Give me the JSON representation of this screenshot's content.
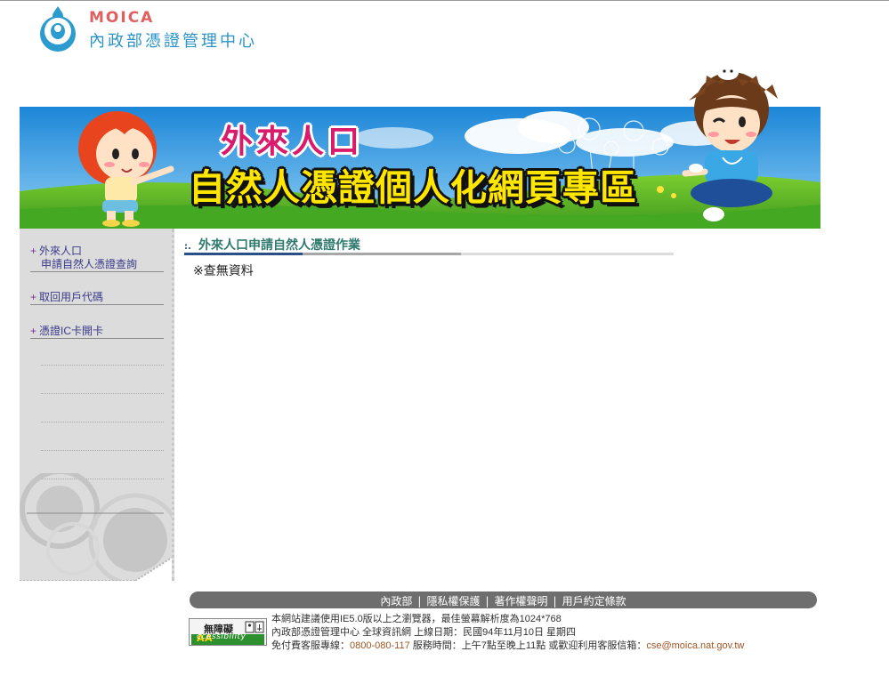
{
  "logo": {
    "en": "MOICA",
    "zh": "內政部憑證管理中心"
  },
  "banner": {
    "line1": "外來人口",
    "line2": "自然人憑證個人化網頁專區"
  },
  "sidebar": {
    "items": [
      {
        "plus": "+",
        "line1": "外來人口",
        "line2": "申請自然人憑證查詢"
      },
      {
        "plus": "+",
        "line1": "取回用戶代碼"
      },
      {
        "plus": "+",
        "line1": "憑證IC卡開卡"
      }
    ]
  },
  "main": {
    "title": "外來人口申請自然人憑證作業",
    "message": "※查無資料"
  },
  "footer": {
    "links": [
      "內政部",
      "隱私權保護",
      "著作權聲明",
      "用戶約定條款"
    ],
    "separator": "|",
    "badge_top": "無障礙",
    "badge_bottom_A": "AA",
    "badge_bottom_rest": "ccessibility",
    "line1": "本網站建議使用IE5.0版以上之瀏覽器，最佳螢幕解析度為1024*768",
    "line2": "內政部憑證管理中心 全球資訊網 上線日期：民國94年11月10日 星期四",
    "line3_prefix": "免付費客服專線：",
    "phone": "0800-080-117",
    "line3_mid": " 服務時間：上午7點至晚上11點 或歡迎利用客服信箱：",
    "email": "cse@moica.nat.gov.tw"
  },
  "colors": {
    "logo_red": "#e06060",
    "logo_blue": "#2b93c8",
    "title_teal": "#2f7a6e",
    "footer_gray": "#6e6e6e"
  }
}
